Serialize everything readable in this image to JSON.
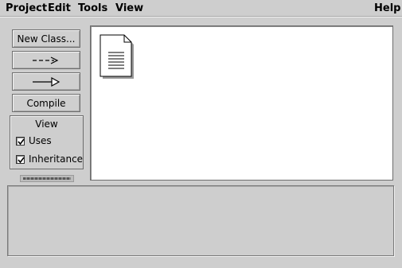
{
  "menu": {
    "project": "Project",
    "edit": "Edit",
    "tools": "Tools",
    "view": "View",
    "help": "Help"
  },
  "toolbar": {
    "new_class": "New Class...",
    "uses_arrow_icon": "dashed-arrow-icon",
    "inheritance_arrow_icon": "hollow-arrow-icon",
    "compile": "Compile"
  },
  "view_panel": {
    "title": "View",
    "uses": {
      "label": "Uses",
      "checked": true
    },
    "inheritance": {
      "label": "Inheritance",
      "checked": true
    }
  },
  "diagram": {
    "items": [
      {
        "icon": "readme-document-icon"
      }
    ]
  },
  "colors": {
    "background": "#cecece",
    "canvas": "#ffffff",
    "border": "#6e6e6e"
  }
}
